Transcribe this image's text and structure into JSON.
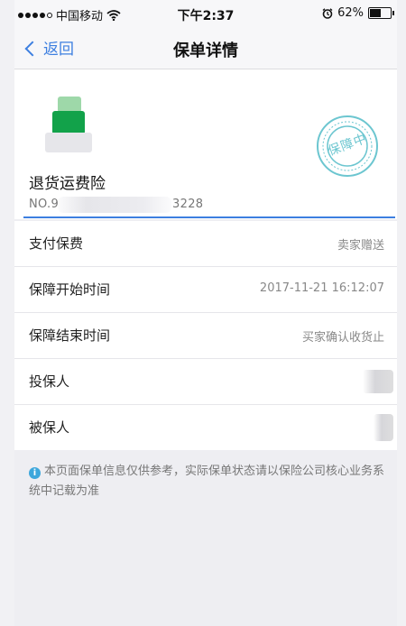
{
  "status_bar": {
    "carrier": "中国移动",
    "time": "下午2:37",
    "battery": "62%",
    "battery_level": 0.62,
    "signal_icon": "signal-dots-icon",
    "wifi_icon": "wifi-icon",
    "alarm_icon": "alarm-icon"
  },
  "nav": {
    "back_label": "返回",
    "title": "保单详情"
  },
  "policy": {
    "name": "退货运费险",
    "number_prefix": "NO.9",
    "number_suffix": "3228",
    "stamp_text": "保障中"
  },
  "rows": [
    {
      "label": "支付保费",
      "value": "卖家赠送"
    },
    {
      "label": "保障开始时间",
      "value": "2017-11-21 16:12:07"
    },
    {
      "label": "保障结束时间",
      "value": "买家确认收货止"
    },
    {
      "label": "投保人",
      "value": ""
    },
    {
      "label": "被保人",
      "value": ""
    }
  ],
  "notice": {
    "text": "本页面保单信息仅供参考，实际保单状态请以保险公司核心业务系统中记载为准"
  },
  "colors": {
    "accent": "#3d7fe0",
    "stamp": "#6cc6d0",
    "info": "#3da7dc"
  }
}
